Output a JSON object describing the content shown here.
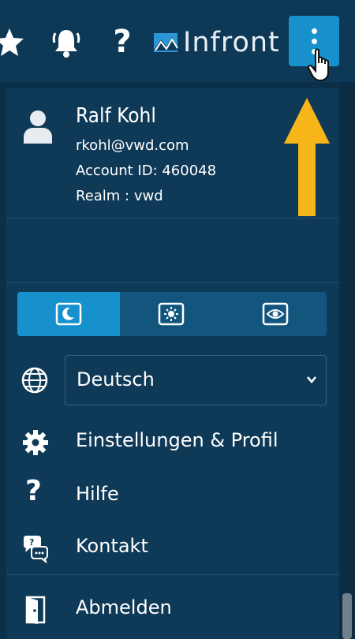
{
  "topbar": {
    "help_glyph": "?",
    "brand_name": "Infront",
    "icons": [
      "star-icon",
      "bell-icon",
      "help-icon",
      "infront-logo-icon",
      "more-vertical-icon"
    ],
    "accent_color": "#1791cc"
  },
  "user": {
    "name": "Ralf Kohl",
    "email": "rkohl@vwd.com",
    "account_id": "Account ID: 460048",
    "realm": "Realm : vwd"
  },
  "theme": {
    "options": [
      "dark-mode-icon",
      "light-mode-icon",
      "contrast-mode-icon"
    ],
    "active": "dark-mode-icon"
  },
  "language": {
    "selected": "Deutsch"
  },
  "menu": {
    "settings": "Einstellungen & Profil",
    "help_glyph": "?",
    "help": "Hilfe",
    "contact": "Kontakt",
    "logout": "Abmelden"
  },
  "annotation": {
    "arrow_color": "#f6b519"
  }
}
